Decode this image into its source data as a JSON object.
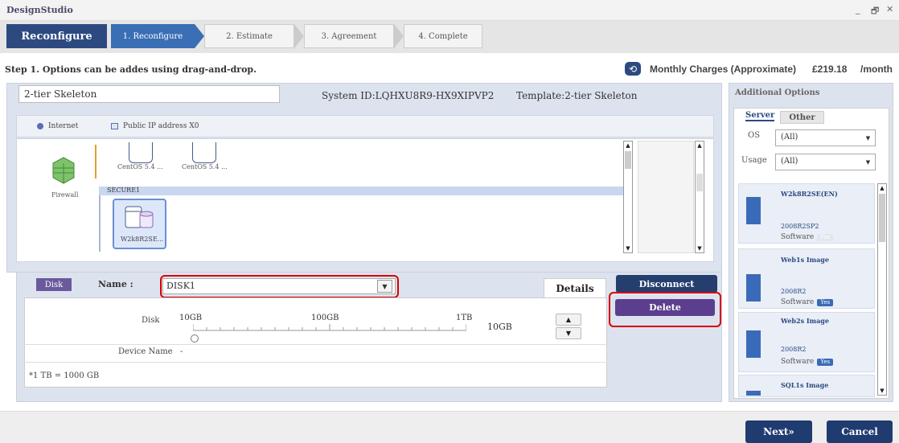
{
  "window": {
    "title": "DesignStudio",
    "controls": {
      "minimize": "_",
      "restore": "🗗",
      "close": "✕"
    }
  },
  "wizard": {
    "main_label": "Reconfigure",
    "steps": [
      {
        "label": "1. Reconfigure",
        "active": true
      },
      {
        "label": "2. Estimate",
        "active": false
      },
      {
        "label": "3. Agreement",
        "active": false
      },
      {
        "label": "4. Complete",
        "active": false
      }
    ]
  },
  "step_bar": {
    "instruction": "Step 1. Options can be addes using drag-and-drop.",
    "refresh_icon": "⟲",
    "charges_label": "Monthly Charges (Approximate)",
    "charges_amount": "£219.18",
    "charges_period": "/month"
  },
  "system": {
    "name_value": "2-tier Skeleton",
    "system_id": "System ID:LQHXU8R9-HX9XIPVP2",
    "template": "Template:2-tier Skeleton"
  },
  "network": {
    "internet_label": "Internet",
    "public_ip_label": "Public IP address X0"
  },
  "diagram": {
    "firewall_label": "Firewall",
    "servers_top": [
      {
        "label": "CentOS 5.4 ..."
      },
      {
        "label": "CentOS 5.4 ..."
      }
    ],
    "segment_label": "SECURE1",
    "selected_server_label": "W2k8R2SE..."
  },
  "disk_panel": {
    "badge": "Disk",
    "name_label": "Name :",
    "name_value": "DISK1",
    "details_tab": "Details",
    "disconnect_label": "Disconnect",
    "delete_label": "Delete",
    "disk_row_label": "Disk",
    "scale": [
      "10GB",
      "100GB",
      "1TB"
    ],
    "slider_value_gb": 10,
    "value_text": "10GB",
    "device_name_label": "Device Name",
    "device_name_value": "-",
    "footnote": "*1 TB = 1000 GB",
    "up_arrow": "▲",
    "down_arrow": "▼"
  },
  "additional_options": {
    "title": "Additional Options",
    "tabs": [
      {
        "label": "Server",
        "active": true
      },
      {
        "label": "Other",
        "active": false
      }
    ],
    "os_label": "OS",
    "os_value": "(All)",
    "usage_label": "Usage",
    "usage_value": "(All)",
    "cards": [
      {
        "title": "W2k8R2SE(EN)",
        "sub": "2008R2SP2",
        "type": "Software",
        "badge": "Pre"
      },
      {
        "title": "Web1s Image",
        "sub": "2008R2",
        "type": "Software",
        "badge": "Yes"
      },
      {
        "title": "Web2s Image",
        "sub": "2008R2",
        "type": "Software",
        "badge": "Yes"
      },
      {
        "title": "SQL1s Image",
        "sub": "",
        "type": "",
        "badge": ""
      }
    ]
  },
  "footer": {
    "next": "Next»",
    "cancel": "Cancel"
  }
}
